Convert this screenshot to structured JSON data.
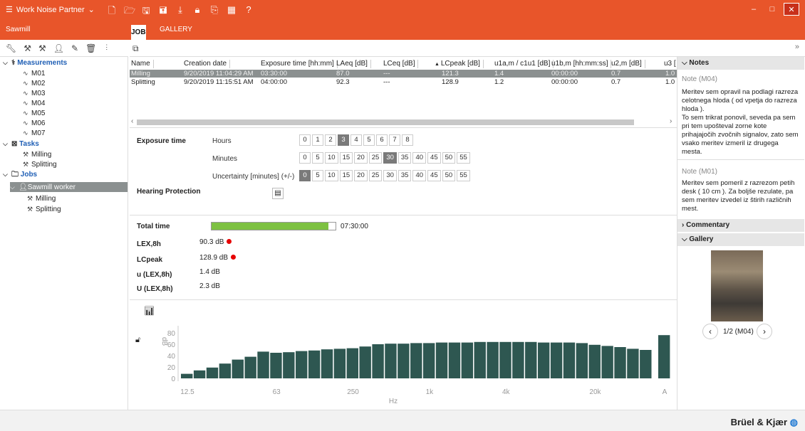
{
  "title_bar": {
    "app_name": "Work Noise Partner",
    "icons": [
      "new-file-icon",
      "open-folder-icon",
      "save-icon",
      "save-as-icon",
      "download-icon",
      "lock-icon",
      "export-icon",
      "calculator-icon",
      "help-icon"
    ],
    "help_label": "?"
  },
  "tabbar": {
    "context": "Sawmill",
    "tabs": [
      {
        "label": "JOB"
      },
      {
        "label": "GALLERY"
      }
    ]
  },
  "tree": {
    "measurements_label": "Measurements",
    "measurements": [
      "M01",
      "M02",
      "M03",
      "M04",
      "M05",
      "M06",
      "M07"
    ],
    "tasks_label": "Tasks",
    "tasks": [
      "Milling",
      "Splitting"
    ],
    "jobs_label": "Jobs",
    "job_name": "Sawmill worker",
    "job_tasks": [
      "Milling",
      "Splitting"
    ]
  },
  "table": {
    "columns": [
      "Name",
      "Creation date",
      "Exposure time [hh:mm]",
      "LAeq [dB]",
      "LCeq [dB]",
      "LCpeak [dB]",
      "u1a,m / c1u1 [dB]",
      "u1b,m [hh:mm:ss]",
      "u2,m [dB]",
      "u3 ["
    ],
    "rows": [
      [
        "Milling",
        "9/20/2019 11:04:29 AM",
        "03:30:00",
        "87.0",
        "---",
        "121.3",
        "1.4",
        "00:00:00",
        "0.7",
        "1.0"
      ],
      [
        "Splitting",
        "9/20/2019 11:15:51 AM",
        "04:00:00",
        "92.3",
        "---",
        "128.9",
        "1.2",
        "00:00:00",
        "0.7",
        "1.0"
      ]
    ]
  },
  "exposure": {
    "section_label": "Exposure time",
    "hours_label": "Hours",
    "hours": [
      "0",
      "1",
      "2",
      "3",
      "4",
      "5",
      "6",
      "7",
      "8"
    ],
    "hours_selected": "3",
    "minutes_label": "Minutes",
    "minutes": [
      "0",
      "5",
      "10",
      "15",
      "20",
      "25",
      "30",
      "35",
      "40",
      "45",
      "50",
      "55"
    ],
    "minutes_selected": "30",
    "uncertainty_label": "Uncertainty [minutes] (+/-)",
    "uncertainty": [
      "0",
      "5",
      "10",
      "15",
      "20",
      "25",
      "30",
      "35",
      "40",
      "45",
      "50",
      "55"
    ],
    "uncertainty_selected": "0",
    "hearing_label": "Hearing Protection"
  },
  "results": {
    "total_time_label": "Total time",
    "total_time_value": "07:30:00",
    "total_time_fraction": 0.94,
    "lex_label": "LEX,8h",
    "lex_value": "90.3 dB",
    "lcpeak_label": "LCpeak",
    "lcpeak_value": "128.9 dB",
    "u_label": "u (LEX,8h)",
    "u_value": "1.4 dB",
    "U_label": "U (LEX,8h)",
    "U_value": "2.3 dB",
    "alert_color": "#e60000"
  },
  "chart_data": {
    "type": "bar",
    "ylabel": "dB",
    "xlabel": "Hz",
    "ylim": [
      0,
      100
    ],
    "yticks": [
      "0",
      "20",
      "40",
      "60",
      "80"
    ],
    "xtick_labels": [
      "12.5",
      "63",
      "250",
      "1k",
      "4k",
      "20k",
      "A"
    ],
    "values": [
      8,
      14,
      19,
      26,
      33,
      38,
      47,
      45,
      46,
      48,
      49,
      51,
      52,
      53,
      56,
      60,
      61,
      61,
      62,
      62,
      63,
      63,
      63,
      64,
      64,
      64,
      64,
      64,
      63,
      63,
      63,
      62,
      59,
      57,
      55,
      52,
      50,
      76
    ],
    "bar_color": "#2e5751"
  },
  "notes": {
    "header": "Notes",
    "items": [
      {
        "title": "Note (M04)",
        "body": "Meritev sem opravil na podlagi razreza celotnega hloda ( od vpetja do razreza hloda ).\nTo sem trikrat ponovil, seveda pa sem pri tem upošteval zorne kote prihajajočih zvočnih signalov, zato sem vsako meritev izmeril iz drugega mesta."
      },
      {
        "title": "Note (M01)",
        "body": "Meritev sem pomeril z razrezom petih desk ( 10 cm ). Za boljše rezulate, pa sem meritev izvedel  iz štirih različnih mest."
      }
    ],
    "commentary_label": "Commentary",
    "gallery_label": "Gallery",
    "gallery_caption": "1/2 (M04)"
  },
  "brand": "Brüel & Kjær"
}
